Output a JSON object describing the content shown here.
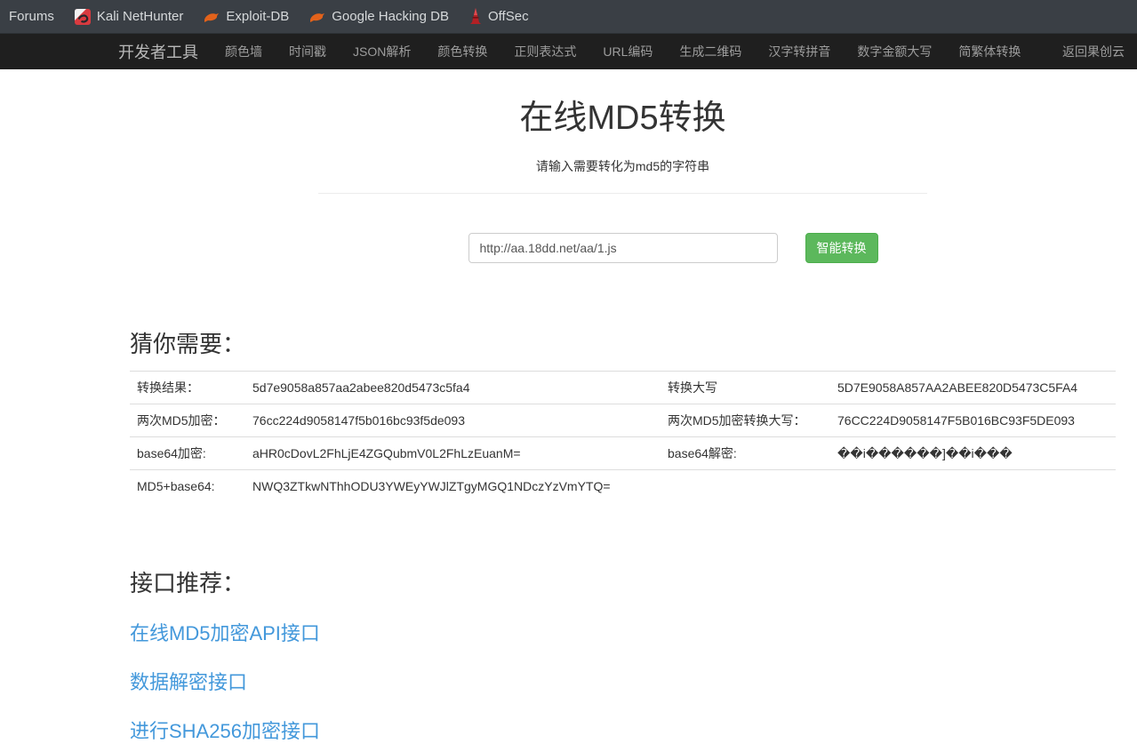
{
  "bookmarks_bar": {
    "items": [
      {
        "label": "Forums"
      },
      {
        "label": "Kali NetHunter"
      },
      {
        "label": "Exploit-DB"
      },
      {
        "label": "Google Hacking DB"
      },
      {
        "label": "OffSec"
      }
    ]
  },
  "navbar": {
    "brand": "开发者工具",
    "items": [
      "颜色墙",
      "时间戳",
      "JSON解析",
      "颜色转换",
      "正则表达式",
      "URL编码",
      "生成二维码",
      "汉字转拼音",
      "数字金额大写",
      "简繁体转换"
    ],
    "right_item": "返回果创云"
  },
  "hero": {
    "title": "在线MD5转换",
    "subtitle": "请输入需要转化为md5的字符串",
    "input_value": "http://aa.18dd.net/aa/1.js",
    "convert_button": "智能转换"
  },
  "results": {
    "heading": "猜你需要：",
    "rows": [
      {
        "label1": "转换结果：",
        "value1": "5d7e9058a857aa2abee820d5473c5fa4",
        "label2": "转换大写",
        "value2": "5D7E9058A857AA2ABEE820D5473C5FA4"
      },
      {
        "label1": "两次MD5加密：",
        "value1": "76cc224d9058147f5b016bc93f5de093",
        "label2": "两次MD5加密转换大写：",
        "value2": "76CC224D9058147F5B016BC93F5DE093"
      },
      {
        "label1": "base64加密:",
        "value1": "aHR0cDovL2FhLjE4ZGQubmV0L2FhLzEuanM=",
        "label2": "base64解密:",
        "value2": "��i������]��i���"
      },
      {
        "label1": "MD5+base64:",
        "value1": "NWQ3ZTkwNThhODU3YWEyYWJlZTgyMGQ1NDczYzVmYTQ=",
        "label2": "",
        "value2": ""
      }
    ]
  },
  "recommendations": {
    "heading": "接口推荐：",
    "links": [
      "在线MD5加密API接口",
      "数据解密接口",
      "进行SHA256加密接口"
    ]
  },
  "colors": {
    "accent_green": "#5cb85c",
    "link_blue": "#4398db",
    "bookmarks_bg": "#3a3f45",
    "navbar_bg": "#1f1f1f"
  }
}
